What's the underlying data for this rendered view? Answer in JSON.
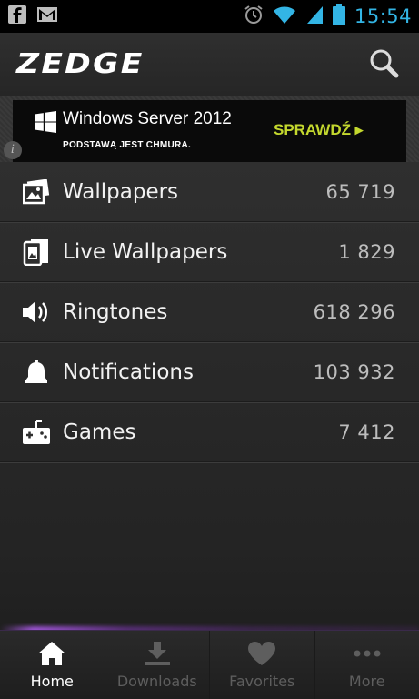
{
  "status_bar": {
    "time": "15:54",
    "left_icons": [
      "facebook-icon",
      "gmail-icon"
    ],
    "right_icons": [
      "alarm-icon",
      "wifi-icon",
      "signal-icon",
      "battery-icon"
    ],
    "accent": "#33b5e5"
  },
  "app_bar": {
    "logo": "ZEDGE",
    "search_icon": "search-icon"
  },
  "ad": {
    "title": "Windows Server 2012",
    "subtitle": "PODSTAWĄ JEST CHMURA.",
    "cta": "SPRAWDŹ ▸",
    "cta_color": "#c4d82e",
    "info_icon": "i"
  },
  "categories": [
    {
      "label": "Wallpapers",
      "count": "65 719",
      "icon": "wallpaper-icon"
    },
    {
      "label": "Live Wallpapers",
      "count": "1 829",
      "icon": "live-wallpaper-icon"
    },
    {
      "label": "Ringtones",
      "count": "618 296",
      "icon": "speaker-icon"
    },
    {
      "label": "Notifications",
      "count": "103 932",
      "icon": "bell-icon"
    },
    {
      "label": "Games",
      "count": "7 412",
      "icon": "gamepad-icon"
    }
  ],
  "bottom_nav": {
    "items": [
      {
        "label": "Home",
        "icon": "home-icon",
        "active": true
      },
      {
        "label": "Downloads",
        "icon": "download-icon",
        "active": false
      },
      {
        "label": "Favorites",
        "icon": "heart-icon",
        "active": false
      },
      {
        "label": "More",
        "icon": "more-icon",
        "active": false
      }
    ],
    "glow_color": "#aa5ae6"
  }
}
